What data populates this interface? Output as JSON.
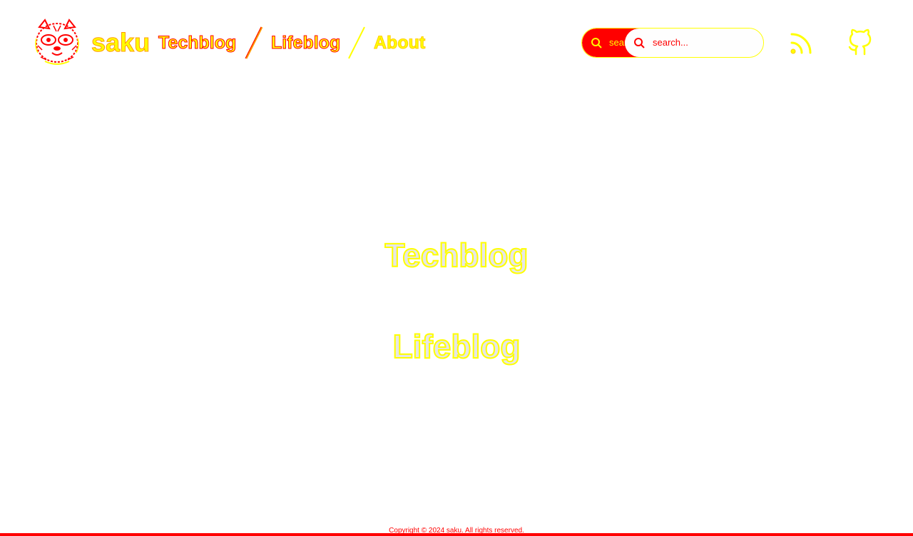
{
  "header": {
    "brand": "saku",
    "nav": [
      {
        "label": "Techblog"
      },
      {
        "label": "Lifeblog"
      },
      {
        "label": "About"
      }
    ],
    "search": {
      "placeholder_left": "search...",
      "placeholder_right": "search..."
    },
    "icons": {
      "logo": "tanuki-logo",
      "rss": "rss-icon",
      "github": "github-icon"
    }
  },
  "main": {
    "links": [
      {
        "label": "Techblog"
      },
      {
        "label": "Lifeblog"
      }
    ]
  },
  "footer": {
    "copyright": "Copyright © 2024 saku. All rights reserved."
  },
  "colors": {
    "accent_red": "#ff0000",
    "accent_yellow": "#ffff00",
    "heading_fill": "#e6e6e6"
  }
}
